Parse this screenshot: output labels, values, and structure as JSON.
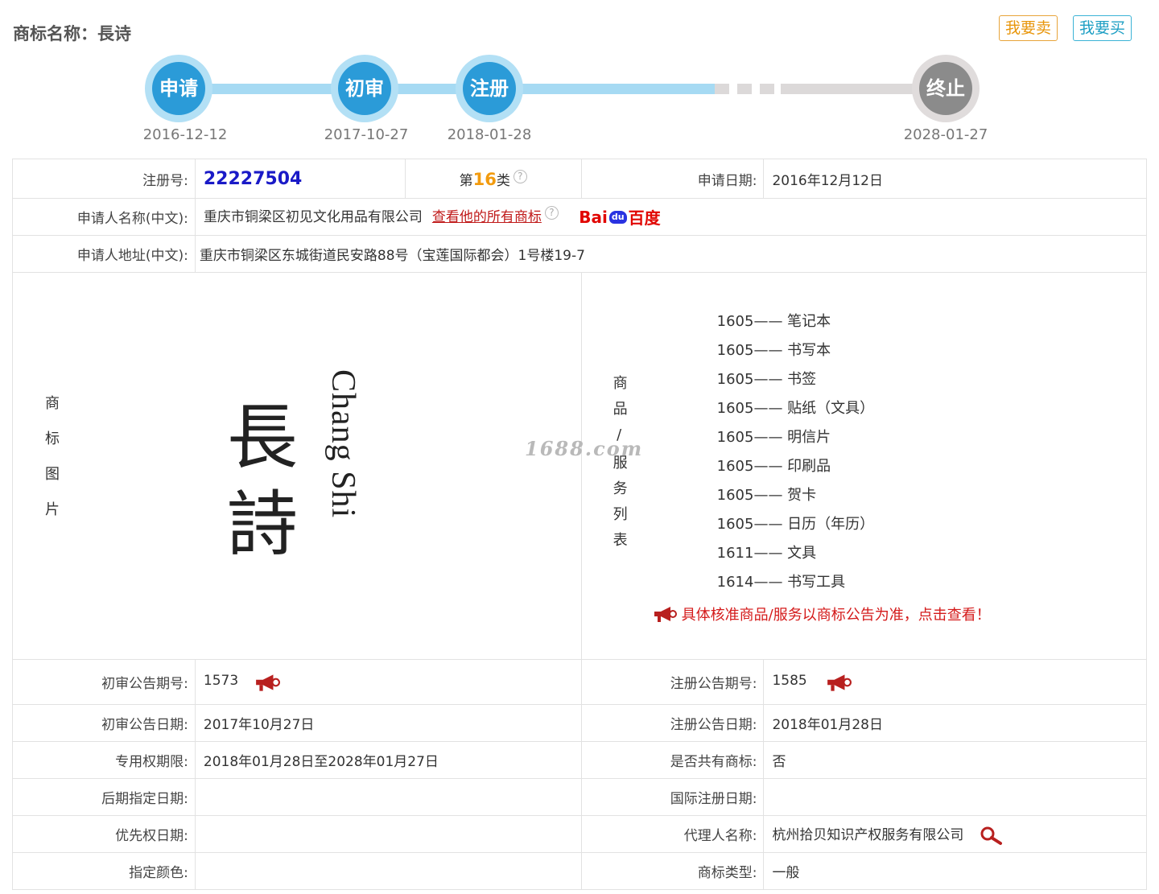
{
  "header": {
    "title": "商标名称：長诗",
    "sell_label": "我要卖",
    "buy_label": "我要买"
  },
  "timeline": {
    "steps": [
      {
        "label": "申请",
        "date": "2016-12-12"
      },
      {
        "label": "初审",
        "date": "2017-10-27"
      },
      {
        "label": "注册",
        "date": "2018-01-28"
      },
      {
        "label": "终止",
        "date": "2028-01-27"
      }
    ]
  },
  "info": {
    "reg_no_label": "注册号:",
    "reg_no": "22227504",
    "class_prefix": "第",
    "class_num": "16",
    "class_suffix": "类",
    "help_glyph": "?",
    "apply_date_label": "申请日期:",
    "apply_date": "2016年12月12日",
    "applicant_label": "申请人名称(中文):",
    "applicant": "重庆市铜梁区初见文化用品有限公司",
    "all_marks_link": "查看他的所有商标",
    "baidu_text1": "Bai",
    "baidu_paw": "du",
    "baidu_text2": "百度",
    "address_label": "申请人地址(中文):",
    "address": "重庆市铜梁区东城街道民安路88号（宝莲国际都会）1号楼19-7"
  },
  "mark_image": {
    "label": "商标图片",
    "cjk_top": "長",
    "cjk_bottom": "詩",
    "latin": "Chang Shi"
  },
  "goods": {
    "label": "商品/服务列表",
    "items": [
      "1605—— 笔记本",
      "1605—— 书写本",
      "1605—— 书签",
      "1605—— 贴纸（文具）",
      "1605—— 明信片",
      "1605—— 印刷品",
      "1605—— 贺卡",
      "1605—— 日历（年历）",
      "1611—— 文具",
      "1614—— 书写工具"
    ],
    "notice": "具体核准商品/服务以商标公告为准，点击查看！"
  },
  "watermark": "1688.com",
  "details": {
    "prelim_no_label": "初审公告期号:",
    "prelim_no": "1573",
    "reg_pub_no_label": "注册公告期号:",
    "reg_pub_no": "1585",
    "prelim_date_label": "初审公告日期:",
    "prelim_date": "2017年10月27日",
    "reg_pub_date_label": "注册公告日期:",
    "reg_pub_date": "2018年01月28日",
    "term_label": "专用权期限:",
    "term": "2018年01月28日至2028年01月27日",
    "shared_label": "是否共有商标:",
    "shared": "否",
    "later_label": "后期指定日期:",
    "later": "",
    "intl_label": "国际注册日期:",
    "intl": "",
    "priority_label": "优先权日期:",
    "priority": "",
    "agent_label": "代理人名称:",
    "agent": "杭州拾贝知识产权服务有限公司",
    "color_label": "指定颜色:",
    "color": "",
    "type_label": "商标类型:",
    "type": "一般"
  },
  "colors": {
    "node_blue": "#2b9bd8",
    "node_grey": "#8b8b8b",
    "link_red": "#c01a1a",
    "reg_no_blue": "#1a1ac7",
    "class_orange": "#f29b0e"
  }
}
